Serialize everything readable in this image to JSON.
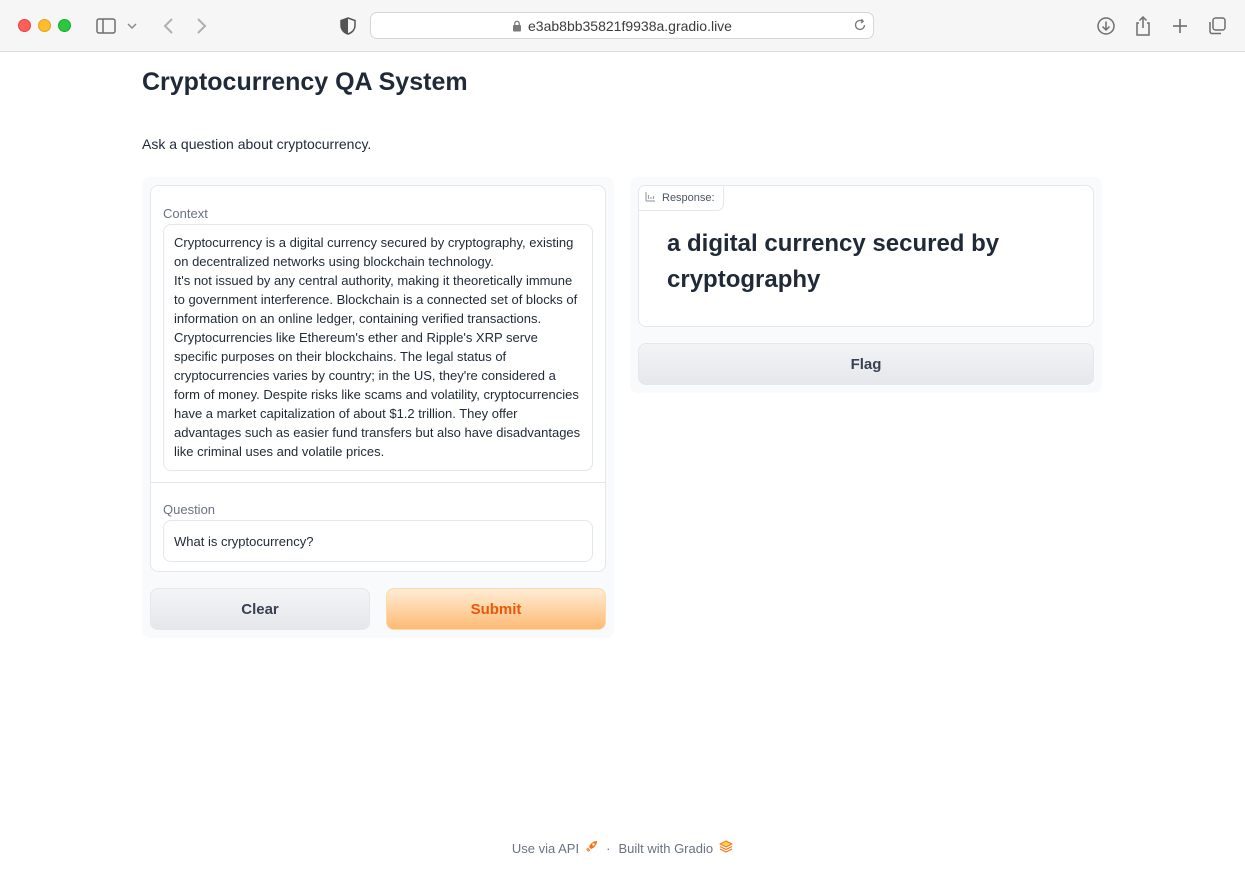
{
  "browser": {
    "url": "e3ab8bb35821f9938a.gradio.live"
  },
  "page": {
    "title": "Cryptocurrency QA System",
    "description": "Ask a question about cryptocurrency."
  },
  "inputs": {
    "context_label": "Context",
    "context_value": "Cryptocurrency is a digital currency secured by cryptography, existing on decentralized networks using blockchain technology.\nIt's not issued by any central authority, making it theoretically immune to government interference. Blockchain is a connected set of blocks of information on an online ledger, containing verified transactions. Cryptocurrencies like Ethereum's ether and Ripple's XRP serve specific purposes on their blockchains. The legal status of cryptocurrencies varies by country; in the US, they're considered a form of money. Despite risks like scams and volatility, cryptocurrencies have a market capitalization of about $1.2 trillion. They offer advantages such as easier fund transfers but also have disadvantages like criminal uses and volatile prices.",
    "question_label": "Question",
    "question_value": "What is cryptocurrency?"
  },
  "buttons": {
    "clear": "Clear",
    "submit": "Submit",
    "flag": "Flag"
  },
  "output": {
    "label": "Response:",
    "value": "a digital currency secured by cryptography"
  },
  "footer": {
    "api": "Use via API",
    "separator": "·",
    "built_with": "Built with Gradio"
  },
  "colors": {
    "accent": "#ea580c",
    "submit_bg": "#fdba74"
  }
}
